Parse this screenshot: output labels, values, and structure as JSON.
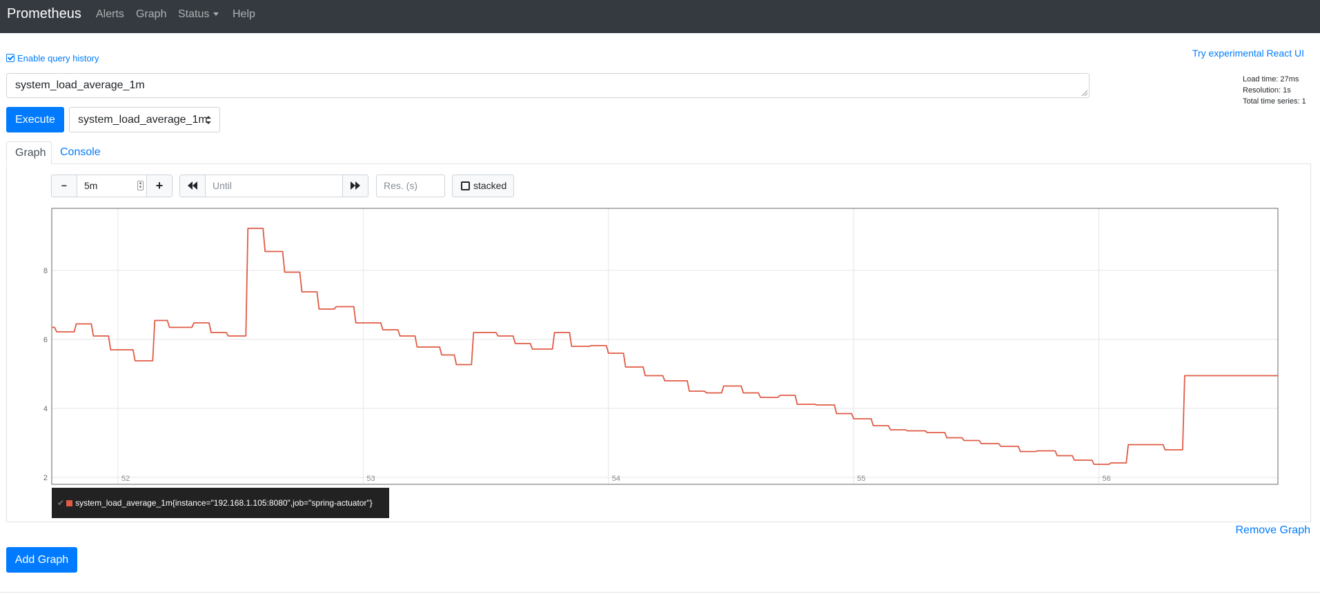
{
  "navbar": {
    "brand": "Prometheus",
    "links": [
      "Alerts",
      "Graph",
      "Status",
      "Help"
    ]
  },
  "query": {
    "enable_history_label": "Enable query history",
    "react_ui_link": "Try experimental React UI",
    "expression": "system_load_average_1m",
    "execute_label": "Execute",
    "metric_selected": "system_load_average_1m",
    "stats": {
      "load_time": "Load time: 27ms",
      "resolution": "Resolution: 1s",
      "total_series": "Total time series: 1"
    }
  },
  "tabs": {
    "graph": "Graph",
    "console": "Console"
  },
  "graph_controls": {
    "range_minus": "−",
    "range_value": "5m",
    "range_plus": "+",
    "until_placeholder": "Until",
    "resolution_placeholder": "Res. (s)",
    "stacked_label": "stacked"
  },
  "legend": {
    "series_label": "system_load_average_1m{instance=\"192.168.1.105:8080\",job=\"spring-actuator\"}",
    "check_glyph": "✔"
  },
  "actions": {
    "remove_graph": "Remove Graph",
    "add_graph": "Add Graph"
  },
  "colors": {
    "navbar_bg": "#343a40",
    "primary": "#007bff",
    "series": "#e05a44"
  },
  "chart_data": {
    "type": "line",
    "title": "",
    "xlabel": "",
    "ylabel": "",
    "ylim": [
      1.8,
      9.8
    ],
    "xlim": [
      51.73,
      56.73
    ],
    "x_ticks": [
      52,
      53,
      54,
      55,
      56
    ],
    "y_ticks": [
      2,
      4,
      6,
      8
    ],
    "grid": true,
    "step": true,
    "series": [
      {
        "name": "system_load_average_1m{instance=\"192.168.1.105:8080\",job=\"spring-actuator\"}",
        "x": [
          51.73,
          51.75,
          51.83,
          51.9,
          51.97,
          52.07,
          52.15,
          52.21,
          52.31,
          52.38,
          52.45,
          52.53,
          52.6,
          52.68,
          52.75,
          52.82,
          52.89,
          52.97,
          53.08,
          53.15,
          53.22,
          53.32,
          53.38,
          53.45,
          53.55,
          53.62,
          53.69,
          53.78,
          53.85,
          53.93,
          54.0,
          54.07,
          54.15,
          54.23,
          54.33,
          54.4,
          54.47,
          54.55,
          54.62,
          54.7,
          54.77,
          54.85,
          54.93,
          55.0,
          55.08,
          55.15,
          55.22,
          55.3,
          55.38,
          55.45,
          55.52,
          55.6,
          55.68,
          55.75,
          55.83,
          55.9,
          55.98,
          56.05,
          56.12,
          56.2,
          56.27,
          56.35,
          56.42,
          56.5,
          56.58,
          56.65,
          56.73
        ],
        "values": [
          6.35,
          6.22,
          6.45,
          6.1,
          5.7,
          5.38,
          6.55,
          6.35,
          6.48,
          6.2,
          6.1,
          9.22,
          8.55,
          7.95,
          7.38,
          6.88,
          6.95,
          6.48,
          6.28,
          6.1,
          5.78,
          5.55,
          5.27,
          6.2,
          6.1,
          5.88,
          5.72,
          6.2,
          5.8,
          5.82,
          5.6,
          5.2,
          4.95,
          4.8,
          4.5,
          4.45,
          4.65,
          4.45,
          4.32,
          4.38,
          4.12,
          4.1,
          3.85,
          3.7,
          3.5,
          3.38,
          3.35,
          3.3,
          3.15,
          3.07,
          2.98,
          2.9,
          2.75,
          2.77,
          2.63,
          2.5,
          2.38,
          2.42,
          2.95,
          2.95,
          2.8,
          4.95,
          4.95,
          4.95,
          4.95,
          4.95,
          4.95
        ]
      }
    ]
  }
}
